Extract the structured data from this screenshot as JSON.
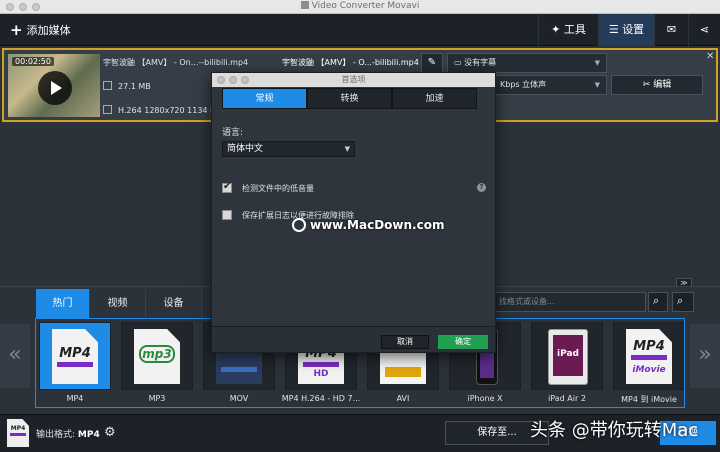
{
  "window": {
    "title": "Video Converter Movavi"
  },
  "toolbar": {
    "add_media": "添加媒体",
    "tools": "工具",
    "settings": "设置"
  },
  "file": {
    "duration": "00:02:50",
    "source_name": "宇智波鼬 【AMV】 - On...--bilibili.mp4",
    "output_name": "宇智波鼬 【AMV】 - O...-bilibili.mp4",
    "size": "27.1 MB",
    "video_info": "H.264 1280x720 1134 Kb",
    "subtitle": "没有字幕",
    "audio": "Kbps 立体声",
    "edit": "编辑"
  },
  "format_tabs": [
    "热门",
    "视频",
    "设备"
  ],
  "format_search": {
    "placeholder": "找格式或设备..."
  },
  "presets": [
    {
      "label": "MP4",
      "icon": "mp4-icon",
      "big": "MP4"
    },
    {
      "label": "MP3",
      "icon": "mp3-icon",
      "big": "mp3"
    },
    {
      "label": "MOV",
      "icon": "mov-icon",
      "big": ""
    },
    {
      "label": "MP4 H.264 - HD 7...",
      "icon": "mp4-hd-icon",
      "big": "MP4",
      "sub": "HD"
    },
    {
      "label": "AVI",
      "icon": "avi-icon",
      "big": ""
    },
    {
      "label": "iPhone X",
      "icon": "iphone-icon"
    },
    {
      "label": "iPad Air 2",
      "icon": "ipad-icon",
      "screen": "iPad"
    },
    {
      "label": "MP4 到 iMovie",
      "icon": "imovie-icon",
      "big": "MP4",
      "sub": "iMovie"
    }
  ],
  "bottom": {
    "output_prefix": "输出格式:",
    "output_format": "MP4",
    "save_to": "保存至...",
    "convert": "转换",
    "overlay_text": "头条 @带你玩转Mac"
  },
  "dialog": {
    "title": "首选项",
    "tabs": [
      "常规",
      "转换",
      "加速"
    ],
    "language_label": "语言:",
    "language_value": "简体中文",
    "check1": "检测文件中的低音量",
    "check2": "保存扩展日志以便进行故障排除",
    "cancel": "取消",
    "ok": "确定",
    "watermark": "www.MacDown.com"
  },
  "colors": {
    "accent": "#1e8be6",
    "ok": "#20a050",
    "highlight": "#d0a227"
  }
}
